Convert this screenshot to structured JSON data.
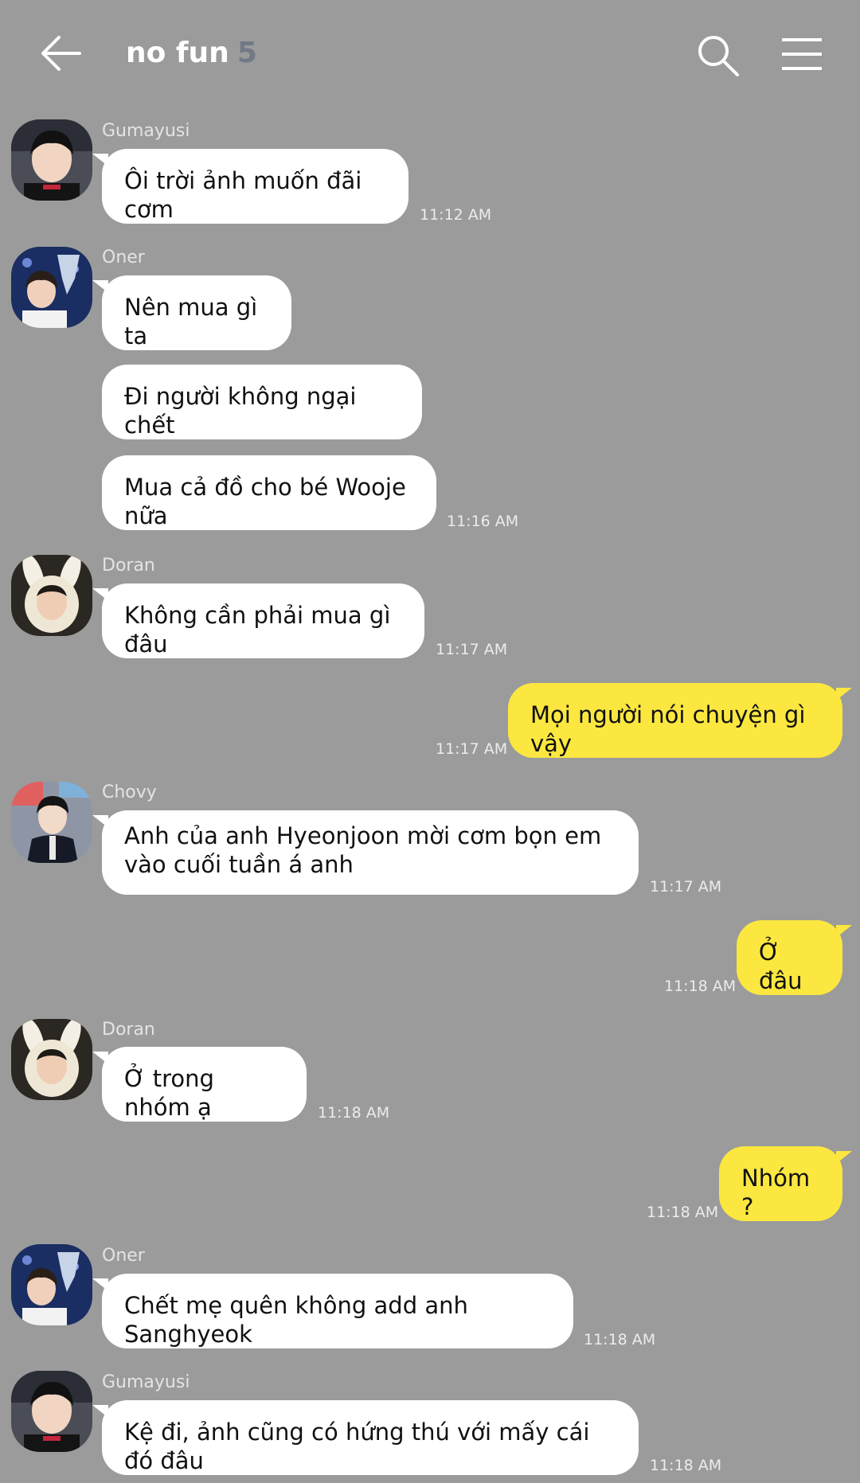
{
  "header": {
    "title": "no fun",
    "member_count": "5"
  },
  "messages": [
    {
      "sender": "Gumayusi",
      "text": "Ôi trời ảnh muốn đãi cơm",
      "time": "11:12 AM"
    },
    {
      "sender": "Oner",
      "text": "Nên mua gì ta"
    },
    {
      "text": "Đi người không ngại chết"
    },
    {
      "text": "Mua cả đồ cho bé Wooje nữa",
      "time": "11:16 AM"
    },
    {
      "sender": "Doran",
      "text": "Không cần phải mua gì đâu",
      "time": "11:17 AM"
    },
    {
      "text": "Mọi người nói chuyện gì vậy",
      "time": "11:17 AM"
    },
    {
      "sender": "Chovy",
      "text": "Anh của anh Hyeonjoon mời cơm bọn em vào cuối tuần á anh",
      "time": "11:17 AM"
    },
    {
      "text": "Ở đâu",
      "time": "11:18 AM"
    },
    {
      "sender": "Doran",
      "text": "Ở trong nhóm ạ",
      "time": "11:18 AM"
    },
    {
      "text": "Nhóm ?",
      "time": "11:18 AM"
    },
    {
      "sender": "Oner",
      "text": "Chết mẹ quên không add anh Sanghyeok",
      "time": "11:18 AM"
    },
    {
      "sender": "Gumayusi",
      "text": "Kệ đi, ảnh cũng có hứng thú với mấy cái đó đâu",
      "time": "11:18 AM"
    }
  ],
  "colors": {
    "background": "#9b9b9b",
    "incoming_bubble": "#ffffff",
    "outgoing_bubble": "#fbe740",
    "member_count": "#727985"
  }
}
